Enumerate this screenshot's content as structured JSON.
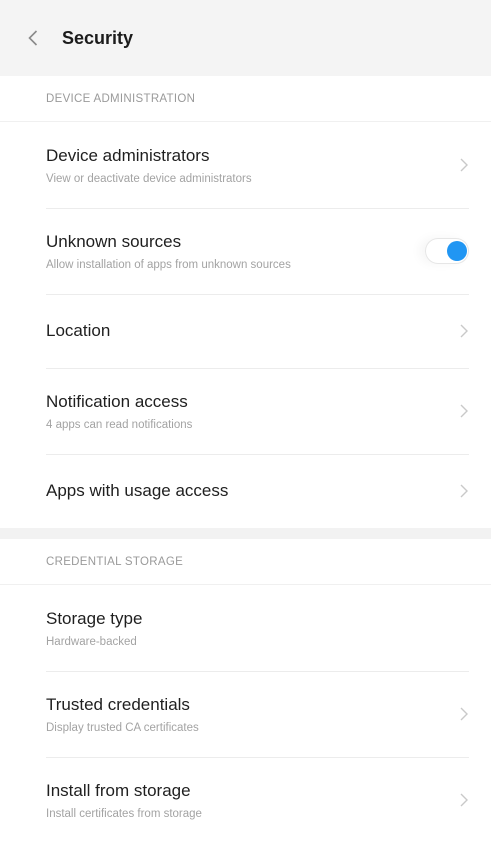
{
  "header": {
    "title": "Security"
  },
  "sections": [
    {
      "label": "DEVICE ADMINISTRATION",
      "items": [
        {
          "title": "Device administrators",
          "subtitle": "View or deactivate device administrators"
        },
        {
          "title": "Unknown sources",
          "subtitle": "Allow installation of apps from unknown sources",
          "toggle_on": true
        },
        {
          "title": "Location"
        },
        {
          "title": "Notification access",
          "subtitle": "4 apps can read notifications"
        },
        {
          "title": "Apps with usage access"
        }
      ]
    },
    {
      "label": "CREDENTIAL STORAGE",
      "items": [
        {
          "title": "Storage type",
          "subtitle": "Hardware-backed"
        },
        {
          "title": "Trusted credentials",
          "subtitle": "Display trusted CA certificates"
        },
        {
          "title": "Install from storage",
          "subtitle": "Install certificates from storage"
        }
      ]
    }
  ],
  "colors": {
    "accent": "#2196f3",
    "header_bg": "#f4f4f4"
  }
}
